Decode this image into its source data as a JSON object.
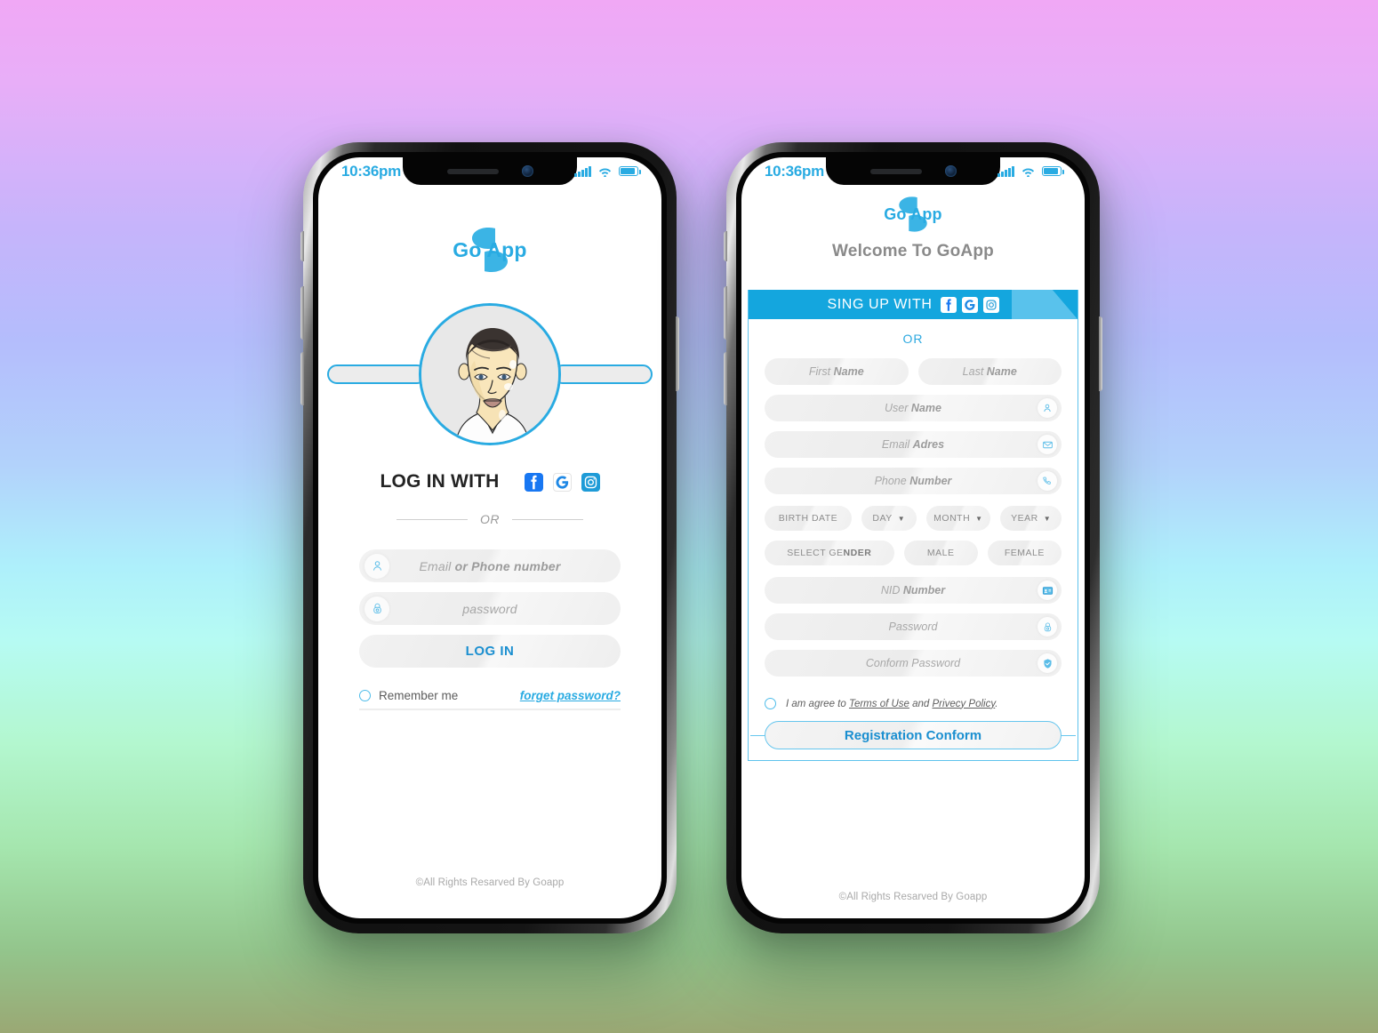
{
  "brand": {
    "name": "Go App",
    "accent": "#29ABE2",
    "header_blue": "#14A6DE"
  },
  "login_phone": {
    "status": {
      "time": "10:36pm",
      "signal": "signal-bars",
      "wifi": "wifi",
      "battery": "battery-full"
    },
    "logo": "Go App",
    "avatar_alt": "user-portrait",
    "social_heading": "LOG IN WITH",
    "social": [
      {
        "name": "facebook",
        "label": "f"
      },
      {
        "name": "google",
        "label": "G"
      },
      {
        "name": "instagram",
        "label": "camera"
      }
    ],
    "divider": "OR",
    "fields": [
      {
        "icon": "person-icon",
        "placeholder_light": "Email ",
        "placeholder_bold": "or Phone number"
      },
      {
        "icon": "lock-icon",
        "placeholder_light": "password",
        "placeholder_bold": ""
      }
    ],
    "submit": "LOG IN",
    "remember": "Remember me",
    "forgot": "forget password?",
    "footer": "©All Rights Resarved By Goapp"
  },
  "signup_phone": {
    "status": {
      "time": "10:36pm"
    },
    "logo": "Go App",
    "welcome": "Welcome To GoApp",
    "card_heading": "SING UP WITH",
    "social": [
      {
        "name": "facebook",
        "label": "f"
      },
      {
        "name": "google",
        "label": "G"
      },
      {
        "name": "instagram",
        "label": "camera"
      }
    ],
    "divider": "OR",
    "name_row": [
      {
        "light": "First ",
        "bold": "Name"
      },
      {
        "light": "Last ",
        "bold": "Name"
      }
    ],
    "fields": [
      {
        "light": "User ",
        "bold": "Name",
        "icon": "person-icon"
      },
      {
        "light": "Email ",
        "bold": "Adres",
        "icon": "envelope-icon"
      },
      {
        "light": "Phone ",
        "bold": "Number",
        "icon": "phone-icon"
      }
    ],
    "birth_row": {
      "label": "BIRTH DATE",
      "selectors": [
        {
          "label": "DAY",
          "caret": "▼"
        },
        {
          "label": "MONTH",
          "caret": "▼"
        },
        {
          "label": "YEAR",
          "caret": "▼"
        }
      ]
    },
    "gender_row": {
      "label_light": "SELECT GE",
      "label_bold": "NDER",
      "options": [
        {
          "label": "MALE"
        },
        {
          "label": "FEMALE"
        }
      ]
    },
    "secure_fields": [
      {
        "light": "NID ",
        "bold": "Number",
        "icon": "id-card-icon"
      },
      {
        "light": "Password",
        "bold": "",
        "icon": "lock-icon"
      },
      {
        "light": "Conform Password",
        "bold": "",
        "icon": "shield-check-icon"
      }
    ],
    "terms": {
      "prefix": "I am agree to ",
      "link1": "Terms of Use",
      "middle": " and ",
      "link2": "Privecy Policy",
      "suffix": "."
    },
    "submit": "Registration Conform",
    "footer": "©All Rights Resarved By Goapp"
  }
}
